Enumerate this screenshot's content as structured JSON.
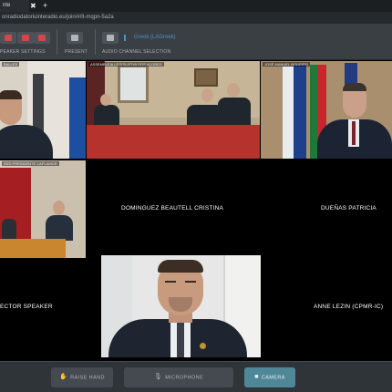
{
  "browser": {
    "tab_title": "nte",
    "tab_close": "✖",
    "new_tab": "+",
    "url": "onradiodatoriuinteradio.eu/join/#/lt-mqpn-5a2a"
  },
  "toolbar": {
    "settings_label": "PEAKER SETTINGS",
    "present_label": "PRESENT",
    "audio_label": "AUDIO CHANNEL SELECTION",
    "language": "Greek (LAGreek)"
  },
  "tiles": [
    {
      "id": "tile-1",
      "caption": "BALLES",
      "name": ""
    },
    {
      "id": "tile-2",
      "caption": "ASSEMBLEIA LEGISLATIVA DOS AÇORES",
      "name": ""
    },
    {
      "id": "tile-3",
      "caption": "JOSÉ MANUEL BOLIEIRO",
      "name": ""
    },
    {
      "id": "tile-4",
      "caption": "RED PRESIDENTE CAPLAMOR",
      "name": ""
    },
    {
      "id": "tile-5",
      "caption": "",
      "name": "DOMINGUEZ BEAUTELL CRISTINA"
    },
    {
      "id": "tile-6",
      "caption": "",
      "name": "DUEÑAS PATRICIA"
    },
    {
      "id": "tile-7",
      "caption": "",
      "name": "ECTOR SPEAKER"
    },
    {
      "id": "tile-8",
      "caption": "",
      "name": ""
    },
    {
      "id": "tile-9",
      "caption": "",
      "name": "ANNE LEZIN (CPMR-IC)"
    }
  ],
  "controls": {
    "raise_hand": "RAISE HAND",
    "microphone": "MICROPHONE",
    "camera": "CAMERA"
  },
  "icons": {
    "hand": "hand-icon",
    "mic": "microphone-icon",
    "camera": "camera-icon",
    "language": "speaker-icon"
  },
  "colors": {
    "accent_camera": "#4f8799",
    "mute_red": "#d3464a",
    "language_blue": "#4b93c9"
  }
}
